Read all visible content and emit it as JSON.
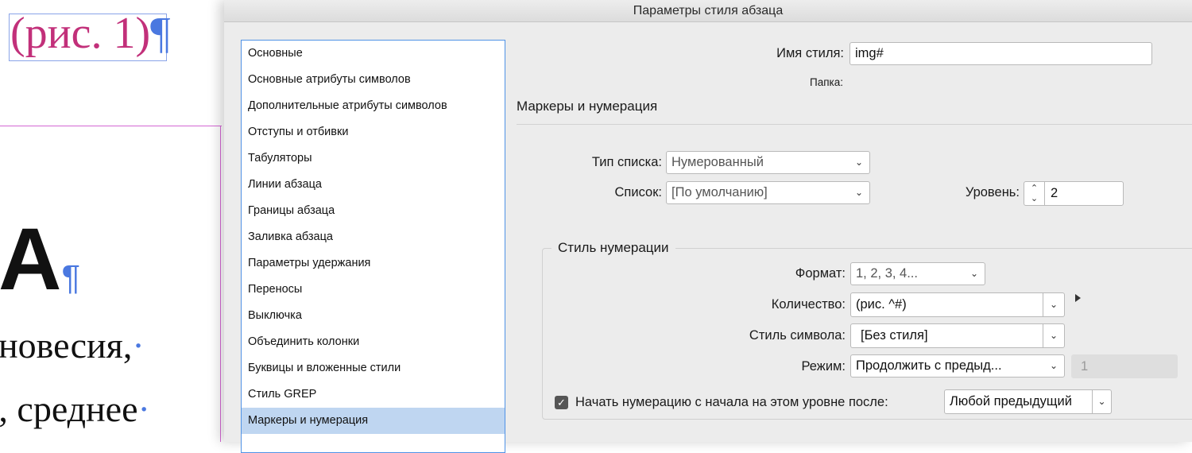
{
  "document": {
    "caption": "(рис. 1)",
    "pilcrow": "¶",
    "big_letter": "A",
    "line1": "новесия,",
    "line2": "е, среднее",
    "dot": "·"
  },
  "dialog": {
    "title": "Параметры стиля абзаца",
    "sidebar": {
      "items": [
        {
          "label": "Основные"
        },
        {
          "label": "Основные атрибуты символов"
        },
        {
          "label": "Дополнительные атрибуты символов"
        },
        {
          "label": "Отступы и отбивки"
        },
        {
          "label": "Табуляторы"
        },
        {
          "label": "Линии абзаца"
        },
        {
          "label": "Границы абзаца"
        },
        {
          "label": "Заливка абзаца"
        },
        {
          "label": "Параметры удержания"
        },
        {
          "label": "Переносы"
        },
        {
          "label": "Выключка"
        },
        {
          "label": "Объединить колонки"
        },
        {
          "label": "Буквицы и вложенные стили"
        },
        {
          "label": "Стиль GREP"
        },
        {
          "label": "Маркеры и нумерация",
          "selected": true
        }
      ]
    },
    "style_name": {
      "label": "Имя стиля:",
      "value": "img#"
    },
    "folder": {
      "label": "Папка:"
    },
    "section_title": "Маркеры и нумерация",
    "list_type": {
      "label": "Тип списка:",
      "value": "Нумерованный"
    },
    "list": {
      "label": "Список:",
      "value": "[По умолчанию]"
    },
    "level": {
      "label": "Уровень:",
      "value": "2"
    },
    "numbering_style": {
      "title": "Стиль нумерации",
      "format": {
        "label": "Формат:",
        "value": "1, 2, 3, 4..."
      },
      "quantity": {
        "label": "Количество:",
        "value": "(рис. ^#)"
      },
      "char_style": {
        "label": "Стиль символа:",
        "value": "[Без стиля]"
      },
      "mode": {
        "label": "Режим:",
        "value": "Продолжить с предыд...",
        "number": "1"
      },
      "restart": {
        "checked": true,
        "label": "Начать нумерацию с начала на этом уровне после:",
        "value": "Любой предыдущий"
      }
    },
    "icons": {
      "chevron": "chevron-down-icon",
      "stepper": "up-down-arrows-icon",
      "check": "checkmark-icon",
      "submenu": "triangle-right-icon"
    },
    "colors": {
      "accent": "#4f92e6",
      "selected_row": "#bfd6f1",
      "caption": "#c2307a",
      "pilcrow": "#4a78e0"
    }
  }
}
